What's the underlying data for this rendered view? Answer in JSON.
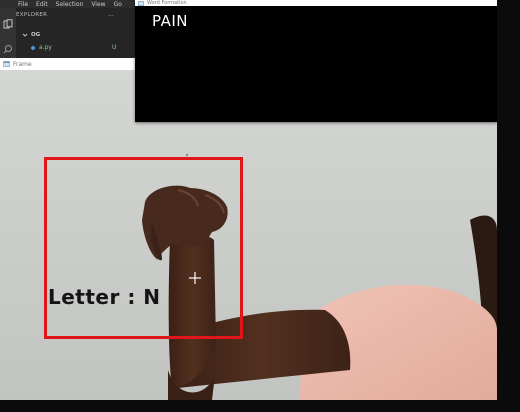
{
  "vscode": {
    "menu": [
      "File",
      "Edit",
      "Selection",
      "View",
      "Go"
    ],
    "explorer_title": "EXPLORER",
    "more_label": "...",
    "folder_name": "OG",
    "file_name": "a.py",
    "file_status": "U",
    "file_color": "#89d185"
  },
  "frame_window": {
    "title": "Frame"
  },
  "word_window": {
    "title": "Word Formation",
    "word": "PAIN"
  },
  "camera": {
    "letter_label": "Letter : N",
    "box_color": "#e0161b"
  }
}
